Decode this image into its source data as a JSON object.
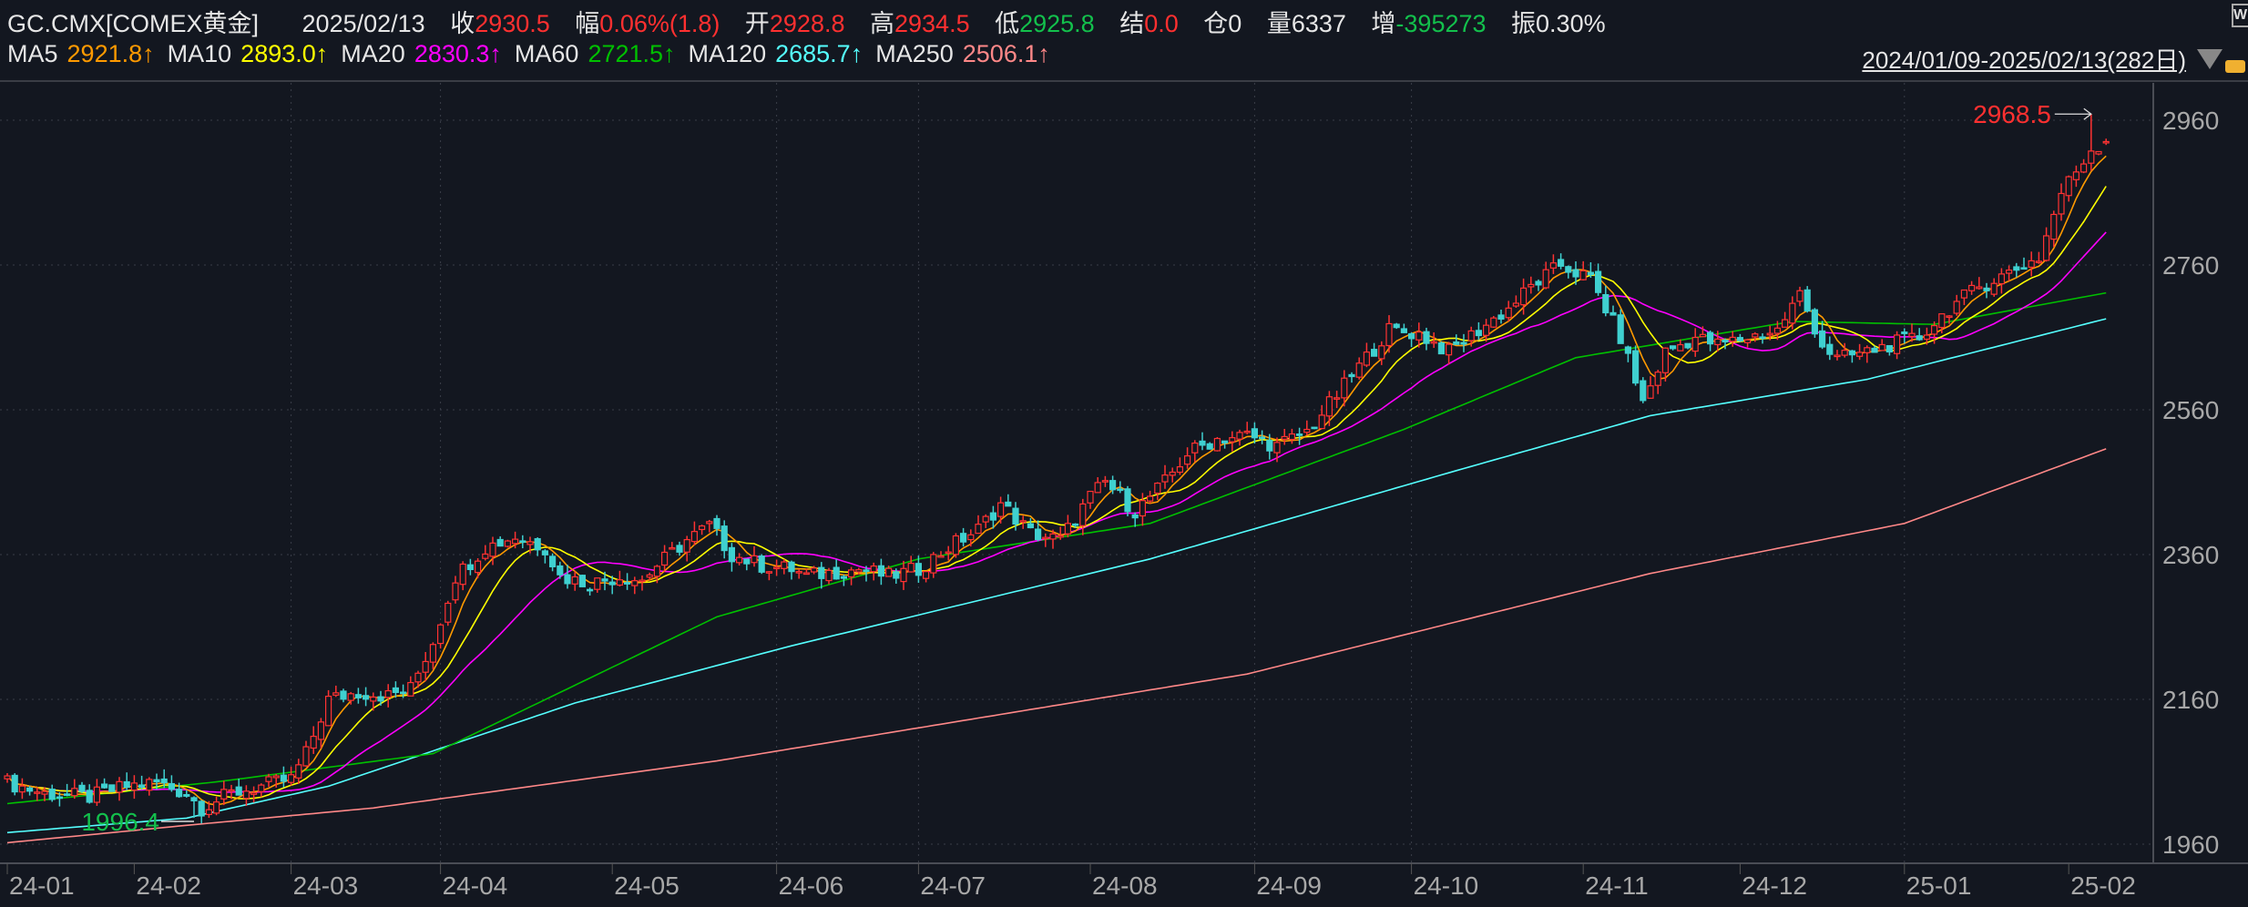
{
  "header": {
    "symbol": "GC.CMX[COMEX黄金]",
    "date": "2025/02/13",
    "close_label": "收",
    "close": "2930.5",
    "change_label": "幅",
    "change": "0.06%(1.8)",
    "open_label": "开",
    "open": "2928.8",
    "high_label": "高",
    "high": "2934.5",
    "low_label": "低",
    "low": "2925.8",
    "settle_label": "结",
    "settle": "0.0",
    "oi_label": "仓",
    "oi": "0",
    "volume_label": "量",
    "volume": "6337",
    "oi_change_label": "增",
    "oi_change": "-395273",
    "amplitude_label": "振",
    "amplitude": "0.30%"
  },
  "ma_legend": [
    {
      "name": "MA5",
      "value": "2921.8↑",
      "color": "#ff9a00"
    },
    {
      "name": "MA10",
      "value": "2893.0↑",
      "color": "#ffff00"
    },
    {
      "name": "MA20",
      "value": "2830.3↑",
      "color": "#ff00ff"
    },
    {
      "name": "MA60",
      "value": "2721.5↑",
      "color": "#00c000"
    },
    {
      "name": "MA120",
      "value": "2685.7↑",
      "color": "#55ffff"
    },
    {
      "name": "MA250",
      "value": "2506.1↑",
      "color": "#ff8888"
    }
  ],
  "range_text": "2024/01/09-2025/02/13(282日)",
  "chart_data": {
    "type": "candlestick",
    "n_days": 282,
    "ylim": [
      1960,
      2960
    ],
    "y_ticks": [
      "2960",
      "2760",
      "2560",
      "2360",
      "2160",
      "1960"
    ],
    "x_labels": [
      {
        "label": "24-01",
        "index": 0,
        "grid": false
      },
      {
        "label": "24-02",
        "index": 17,
        "grid": false
      },
      {
        "label": "24-03",
        "index": 38,
        "grid": true
      },
      {
        "label": "24-04",
        "index": 58,
        "grid": true
      },
      {
        "label": "24-05",
        "index": 81,
        "grid": false
      },
      {
        "label": "24-06",
        "index": 103,
        "grid": true
      },
      {
        "label": "24-07",
        "index": 122,
        "grid": true
      },
      {
        "label": "24-08",
        "index": 145,
        "grid": false
      },
      {
        "label": "24-09",
        "index": 167,
        "grid": true
      },
      {
        "label": "24-10",
        "index": 188,
        "grid": true
      },
      {
        "label": "24-11",
        "index": 211,
        "grid": false
      },
      {
        "label": "24-12",
        "index": 232,
        "grid": false
      },
      {
        "label": "25-01",
        "index": 254,
        "grid": true
      },
      {
        "label": "25-02",
        "index": 276,
        "grid": false
      }
    ],
    "close_anchors": [
      [
        0,
        2045
      ],
      [
        5,
        2030
      ],
      [
        11,
        2025
      ],
      [
        16,
        2040
      ],
      [
        20,
        2045
      ],
      [
        24,
        2030
      ],
      [
        26,
        2010
      ],
      [
        30,
        2030
      ],
      [
        36,
        2045
      ],
      [
        38,
        2050
      ],
      [
        40,
        2085
      ],
      [
        43,
        2160
      ],
      [
        47,
        2170
      ],
      [
        51,
        2165
      ],
      [
        54,
        2175
      ],
      [
        57,
        2240
      ],
      [
        60,
        2330
      ],
      [
        64,
        2370
      ],
      [
        68,
        2385
      ],
      [
        72,
        2370
      ],
      [
        74,
        2330
      ],
      [
        78,
        2320
      ],
      [
        82,
        2330
      ],
      [
        85,
        2325
      ],
      [
        87,
        2345
      ],
      [
        91,
        2380
      ],
      [
        94,
        2400
      ],
      [
        97,
        2360
      ],
      [
        101,
        2345
      ],
      [
        105,
        2340
      ],
      [
        107,
        2330
      ],
      [
        110,
        2335
      ],
      [
        114,
        2340
      ],
      [
        118,
        2330
      ],
      [
        122,
        2340
      ],
      [
        126,
        2370
      ],
      [
        130,
        2395
      ],
      [
        133,
        2430
      ],
      [
        137,
        2390
      ],
      [
        141,
        2380
      ],
      [
        145,
        2440
      ],
      [
        147,
        2460
      ],
      [
        151,
        2420
      ],
      [
        155,
        2460
      ],
      [
        158,
        2500
      ],
      [
        162,
        2520
      ],
      [
        166,
        2525
      ],
      [
        170,
        2510
      ],
      [
        174,
        2530
      ],
      [
        178,
        2580
      ],
      [
        181,
        2620
      ],
      [
        185,
        2670
      ],
      [
        189,
        2665
      ],
      [
        193,
        2640
      ],
      [
        197,
        2670
      ],
      [
        201,
        2700
      ],
      [
        204,
        2730
      ],
      [
        208,
        2760
      ],
      [
        212,
        2740
      ],
      [
        216,
        2660
      ],
      [
        219,
        2570
      ],
      [
        222,
        2640
      ],
      [
        226,
        2660
      ],
      [
        229,
        2650
      ],
      [
        233,
        2660
      ],
      [
        237,
        2670
      ],
      [
        240,
        2720
      ],
      [
        243,
        2650
      ],
      [
        245,
        2630
      ],
      [
        249,
        2640
      ],
      [
        252,
        2650
      ],
      [
        256,
        2660
      ],
      [
        260,
        2700
      ],
      [
        264,
        2730
      ],
      [
        268,
        2750
      ],
      [
        272,
        2770
      ],
      [
        275,
        2860
      ],
      [
        279,
        2920
      ],
      [
        281,
        2930
      ]
    ],
    "last_candle": {
      "open": 2928.8,
      "high": 2934.5,
      "low": 2925.8,
      "close": 2930.5
    },
    "max_marker": {
      "label": "2968.5",
      "value": 2968.5,
      "index": 279
    },
    "min_marker": {
      "label": "1996.4",
      "value": 1996.4,
      "index": 25
    },
    "ma_long_anchors": {
      "MA60": [
        [
          0,
          2016
        ],
        [
          28,
          2046
        ],
        [
          57,
          2085
        ],
        [
          95,
          2274
        ],
        [
          122,
          2354
        ],
        [
          153,
          2403
        ],
        [
          187,
          2533
        ],
        [
          210,
          2632
        ],
        [
          239,
          2682
        ],
        [
          258,
          2678
        ],
        [
          281,
          2721.5
        ]
      ],
      "MA120": [
        [
          0,
          1976
        ],
        [
          24,
          1996
        ],
        [
          43,
          2040
        ],
        [
          76,
          2155
        ],
        [
          105,
          2234
        ],
        [
          153,
          2354
        ],
        [
          193,
          2473
        ],
        [
          220,
          2552
        ],
        [
          249,
          2602
        ],
        [
          281,
          2685.7
        ]
      ],
      "MA250": [
        [
          0,
          1962
        ],
        [
          24,
          1986
        ],
        [
          49,
          2010
        ],
        [
          95,
          2075
        ],
        [
          166,
          2195
        ],
        [
          220,
          2334
        ],
        [
          254,
          2403
        ],
        [
          281,
          2506.1
        ]
      ]
    },
    "colors": {
      "up": "#ff3232",
      "down": "#3fd0d0",
      "max_label": "#ff3030",
      "min_label": "#13c04c"
    }
  }
}
